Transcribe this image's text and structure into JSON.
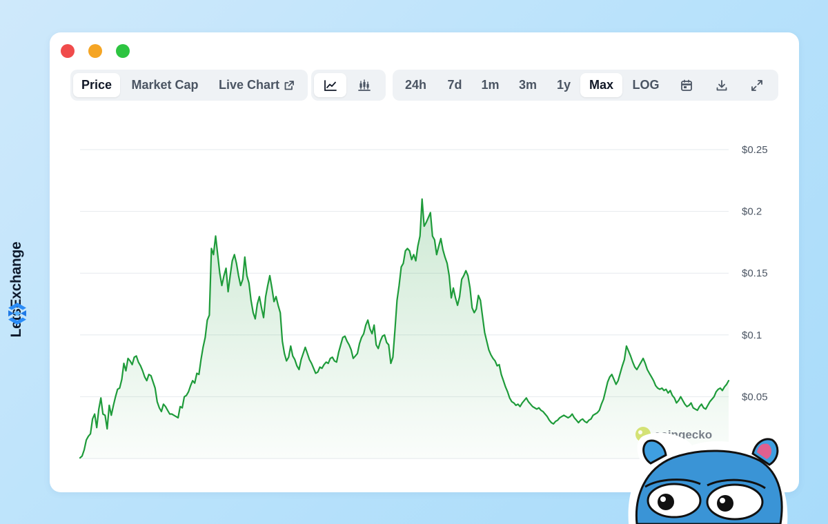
{
  "brand": {
    "name": "LetsExchange",
    "logo_icon": "lets-exchange-logo-icon"
  },
  "window": {
    "controls": [
      {
        "name": "close",
        "color": "#f04b4b"
      },
      {
        "name": "minimize",
        "color": "#f5a524"
      },
      {
        "name": "maximize",
        "color": "#2dc441"
      }
    ]
  },
  "tabs": {
    "items": [
      {
        "label": "Price",
        "active": true
      },
      {
        "label": "Market Cap",
        "active": false
      },
      {
        "label": "Live Chart",
        "active": false,
        "icon": "external-link-icon"
      }
    ]
  },
  "chart_type_toggle": {
    "items": [
      {
        "icon": "line-chart-icon",
        "active": true
      },
      {
        "icon": "candlestick-chart-icon",
        "active": false
      }
    ]
  },
  "range": {
    "items": [
      {
        "label": "24h",
        "active": false
      },
      {
        "label": "7d",
        "active": false
      },
      {
        "label": "1m",
        "active": false
      },
      {
        "label": "3m",
        "active": false
      },
      {
        "label": "1y",
        "active": false
      },
      {
        "label": "Max",
        "active": true
      },
      {
        "label": "LOG",
        "active": false
      }
    ],
    "icons": [
      "calendar-icon",
      "download-icon",
      "expand-icon"
    ]
  },
  "watermark": {
    "text": "coingecko",
    "icon": "coingecko-logo-icon"
  },
  "mascot": {
    "icon": "blue-bear-mascot-icon"
  },
  "chart_data": {
    "type": "area",
    "title": "",
    "xlabel": "",
    "ylabel": "",
    "ylim": [
      0,
      0.25
    ],
    "y_ticks": [
      0.05,
      0.1,
      0.15,
      0.2,
      0.25
    ],
    "y_tick_labels": [
      "$0.05",
      "$0.1",
      "$0.15",
      "$0.2",
      "$0.25"
    ],
    "grid": true,
    "line_color": "#1e9b3a",
    "fill_color": "#1e9b3a",
    "series": [
      {
        "values": [
          0.0005,
          0.002,
          0.007,
          0.015,
          0.018,
          0.02,
          0.032,
          0.036,
          0.025,
          0.04,
          0.049,
          0.036,
          0.035,
          0.024,
          0.043,
          0.035,
          0.043,
          0.05,
          0.056,
          0.057,
          0.064,
          0.077,
          0.071,
          0.081,
          0.079,
          0.076,
          0.082,
          0.083,
          0.078,
          0.075,
          0.071,
          0.066,
          0.063,
          0.068,
          0.067,
          0.062,
          0.057,
          0.046,
          0.041,
          0.038,
          0.044,
          0.042,
          0.039,
          0.036,
          0.036,
          0.035,
          0.034,
          0.033,
          0.042,
          0.041,
          0.05,
          0.051,
          0.054,
          0.059,
          0.063,
          0.061,
          0.069,
          0.068,
          0.08,
          0.09,
          0.098,
          0.112,
          0.116,
          0.17,
          0.165,
          0.18,
          0.165,
          0.15,
          0.14,
          0.148,
          0.154,
          0.135,
          0.148,
          0.16,
          0.165,
          0.158,
          0.148,
          0.14,
          0.145,
          0.163,
          0.148,
          0.142,
          0.128,
          0.118,
          0.113,
          0.125,
          0.131,
          0.122,
          0.114,
          0.131,
          0.14,
          0.148,
          0.138,
          0.127,
          0.131,
          0.124,
          0.118,
          0.095,
          0.085,
          0.079,
          0.082,
          0.091,
          0.083,
          0.08,
          0.075,
          0.072,
          0.08,
          0.085,
          0.09,
          0.085,
          0.08,
          0.077,
          0.073,
          0.069,
          0.07,
          0.074,
          0.073,
          0.076,
          0.078,
          0.077,
          0.081,
          0.082,
          0.079,
          0.078,
          0.086,
          0.092,
          0.098,
          0.099,
          0.095,
          0.092,
          0.088,
          0.081,
          0.083,
          0.085,
          0.093,
          0.098,
          0.101,
          0.108,
          0.112,
          0.105,
          0.101,
          0.108,
          0.092,
          0.089,
          0.095,
          0.099,
          0.1,
          0.094,
          0.092,
          0.077,
          0.082,
          0.104,
          0.128,
          0.14,
          0.155,
          0.158,
          0.168,
          0.17,
          0.168,
          0.161,
          0.165,
          0.16,
          0.172,
          0.18,
          0.21,
          0.188,
          0.191,
          0.195,
          0.199,
          0.18,
          0.177,
          0.165,
          0.172,
          0.178,
          0.169,
          0.163,
          0.158,
          0.148,
          0.13,
          0.138,
          0.13,
          0.124,
          0.131,
          0.145,
          0.148,
          0.152,
          0.148,
          0.138,
          0.122,
          0.118,
          0.121,
          0.132,
          0.128,
          0.115,
          0.102,
          0.095,
          0.088,
          0.084,
          0.081,
          0.079,
          0.075,
          0.076,
          0.068,
          0.063,
          0.058,
          0.054,
          0.049,
          0.046,
          0.045,
          0.043,
          0.044,
          0.042,
          0.045,
          0.047,
          0.049,
          0.046,
          0.044,
          0.042,
          0.041,
          0.04,
          0.041,
          0.039,
          0.038,
          0.036,
          0.034,
          0.031,
          0.029,
          0.028,
          0.03,
          0.031,
          0.033,
          0.034,
          0.035,
          0.034,
          0.033,
          0.034,
          0.036,
          0.033,
          0.031,
          0.029,
          0.031,
          0.032,
          0.03,
          0.029,
          0.031,
          0.032,
          0.035,
          0.036,
          0.037,
          0.039,
          0.044,
          0.048,
          0.055,
          0.062,
          0.066,
          0.068,
          0.064,
          0.06,
          0.063,
          0.069,
          0.075,
          0.08,
          0.091,
          0.087,
          0.083,
          0.078,
          0.074,
          0.072,
          0.075,
          0.078,
          0.081,
          0.077,
          0.072,
          0.069,
          0.066,
          0.063,
          0.059,
          0.057,
          0.056,
          0.057,
          0.055,
          0.056,
          0.053,
          0.055,
          0.051,
          0.049,
          0.045,
          0.047,
          0.05,
          0.047,
          0.044,
          0.042,
          0.043,
          0.045,
          0.041,
          0.04,
          0.039,
          0.042,
          0.044,
          0.041,
          0.04,
          0.043,
          0.046,
          0.048,
          0.05,
          0.054,
          0.056,
          0.057,
          0.055,
          0.058,
          0.06,
          0.063
        ]
      }
    ]
  }
}
